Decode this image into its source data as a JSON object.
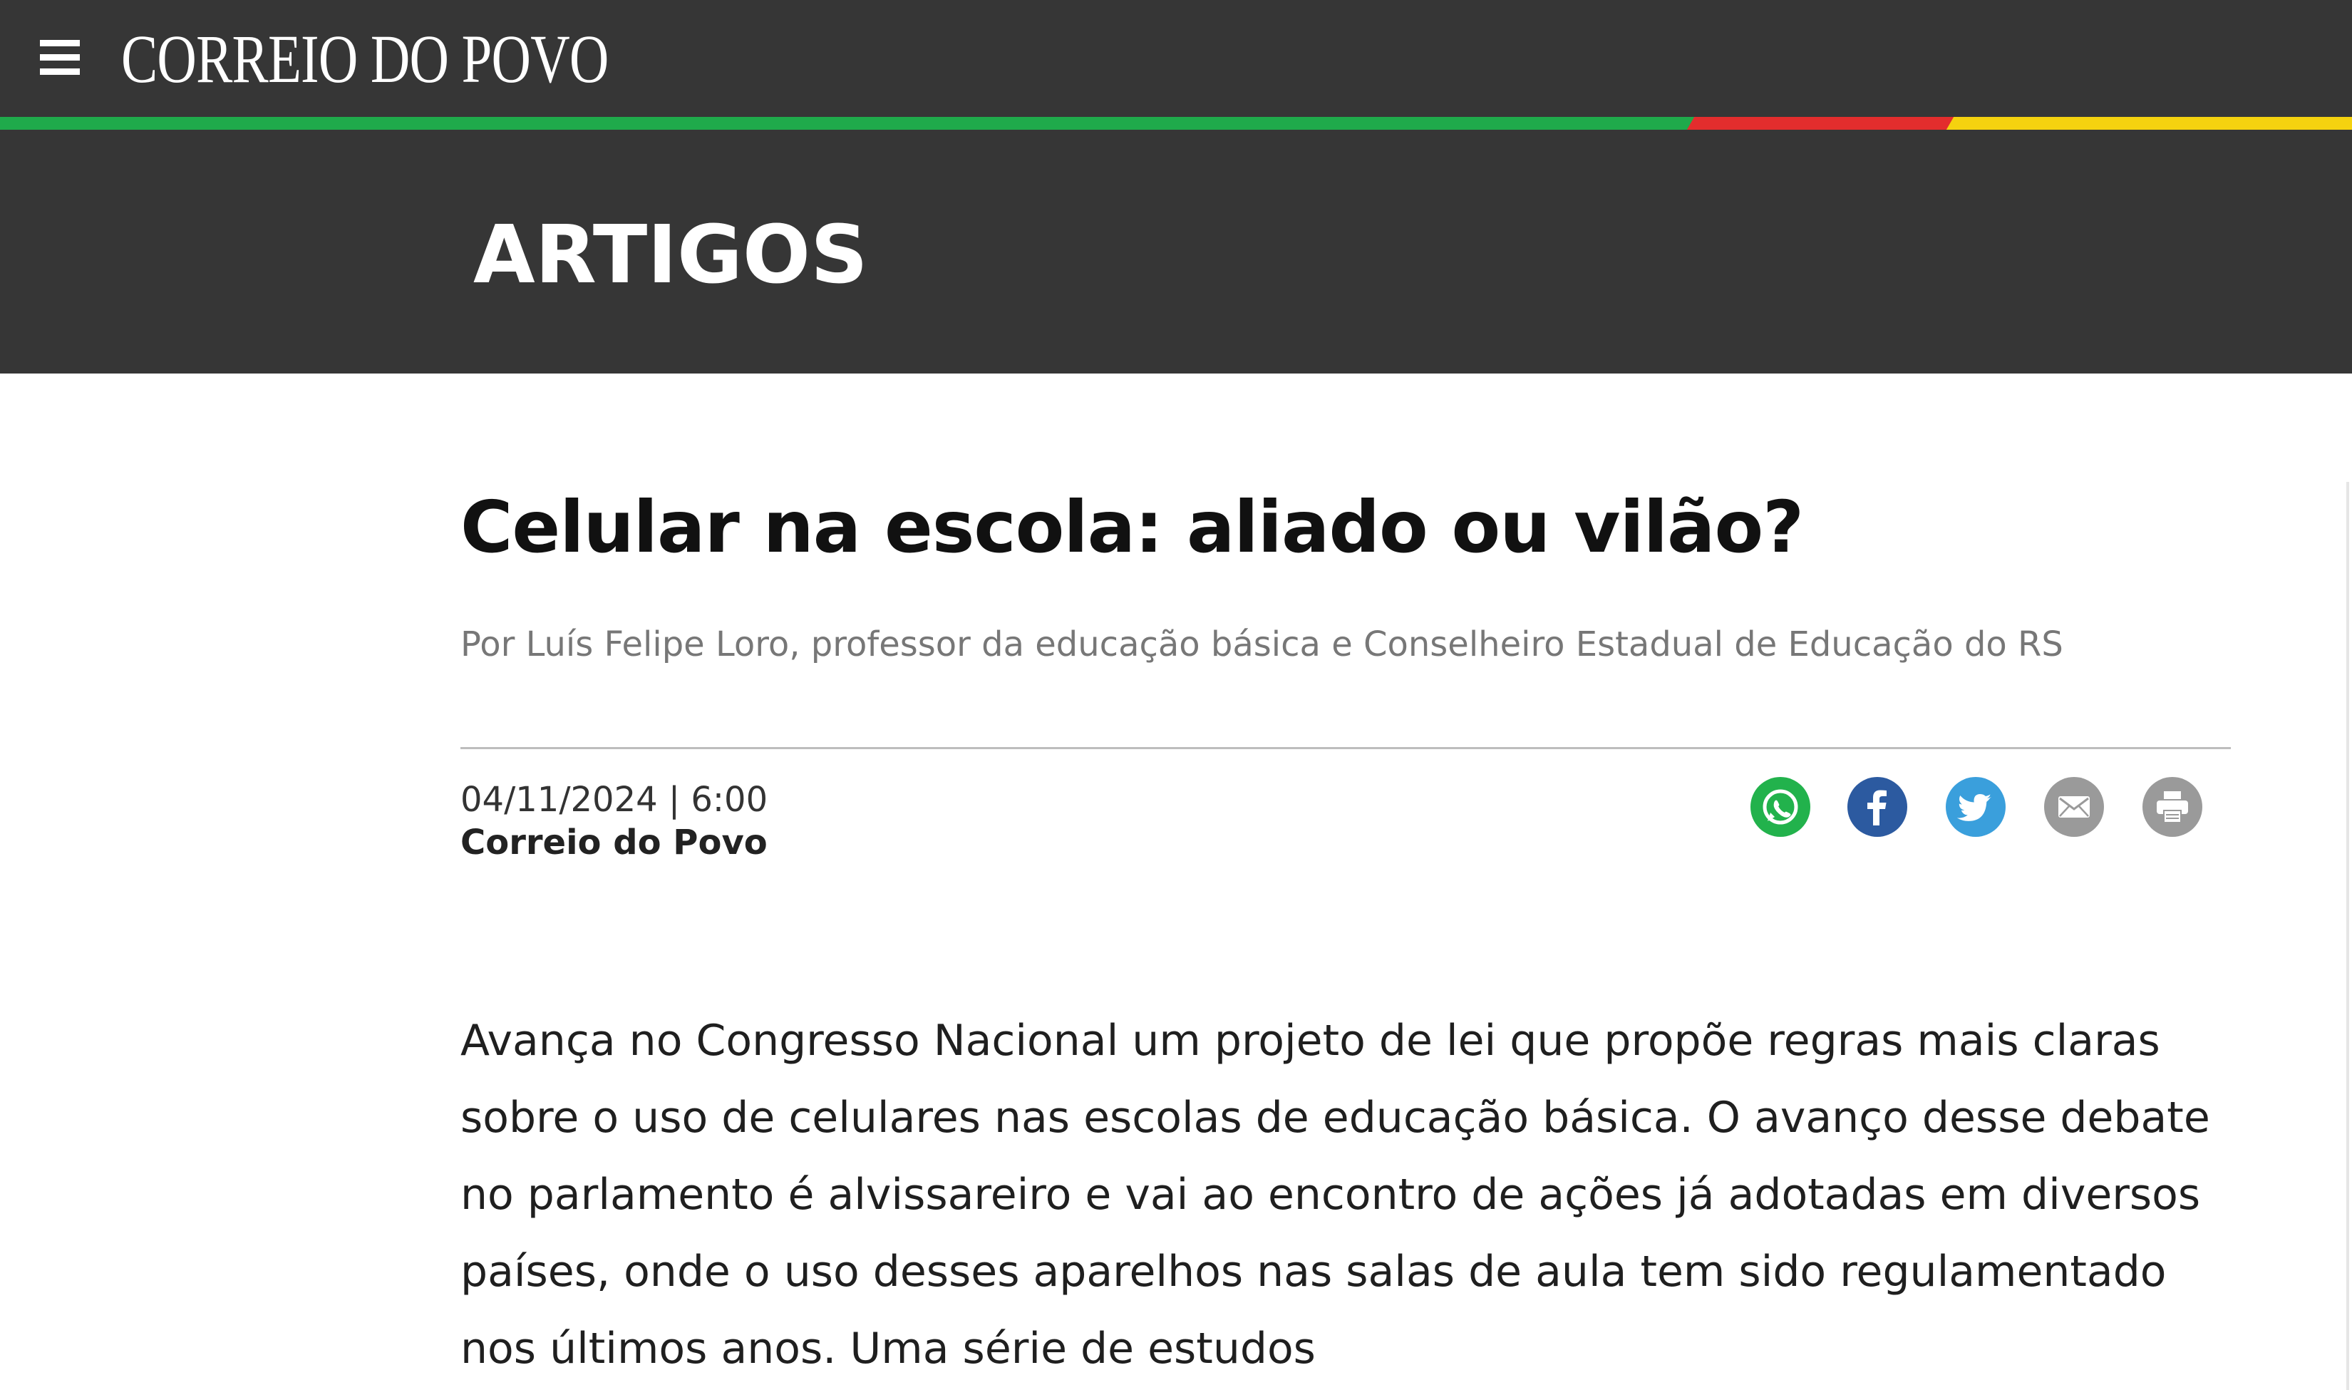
{
  "header": {
    "menu_icon": "hamburger-menu-icon",
    "logo_text": "CORREIO DO POVO",
    "stripe_colors": [
      "#1faa4b",
      "#e32d2d",
      "#f5d20f"
    ],
    "background": "#363636"
  },
  "section": {
    "title": "ARTIGOS"
  },
  "article": {
    "headline": "Celular na escola: aliado ou vilão?",
    "byline": "Por Luís Felipe Loro, professor da educação básica e Conselheiro Estadual de Educação do RS",
    "date": "04/11/2024 | 6:00",
    "source": "Correio do Povo",
    "share": [
      {
        "name": "whatsapp",
        "icon": "whatsapp-icon",
        "color": "#22b24c"
      },
      {
        "name": "facebook",
        "icon": "facebook-icon",
        "color": "#2c5aa0"
      },
      {
        "name": "twitter",
        "icon": "twitter-icon",
        "color": "#3a9fdc"
      },
      {
        "name": "email",
        "icon": "email-icon",
        "color": "#9a9a9a"
      },
      {
        "name": "print",
        "icon": "print-icon",
        "color": "#9a9a9a"
      }
    ],
    "body": "Avança no Congresso Nacional um projeto de lei que propõe regras mais claras sobre o uso de celulares nas escolas de educação básica. O avanço desse debate no parlamento é alvissareiro e vai ao encontro de ações já adotadas em diversos países, onde o uso desses aparelhos nas salas de aula tem sido regulamentado nos últimos anos. Uma série de estudos"
  }
}
